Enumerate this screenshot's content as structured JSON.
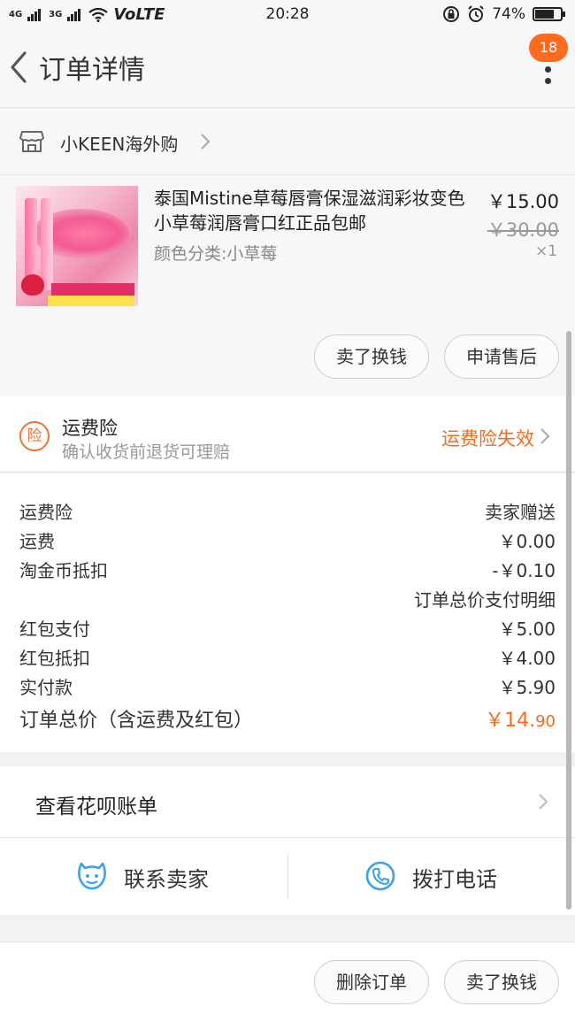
{
  "status_bar": {
    "signal1": "4G",
    "signal2": "3G",
    "volte": "VoLTE",
    "time": "20:28",
    "battery": "74%",
    "battery_level": 0.74
  },
  "header": {
    "title": "订单详情",
    "badge": "18"
  },
  "shop": {
    "name": "小KEEN海外购"
  },
  "item": {
    "title": "泰国Mistine草莓唇膏保湿滋润彩妆变色小草莓润唇膏口红正品包邮",
    "spec": "颜色分类:小草莓",
    "price": "￥15.00",
    "original_price": "￥30.00",
    "quantity": "×1",
    "actions": [
      "卖了换钱",
      "申请售后"
    ]
  },
  "insurance": {
    "title": "运费险",
    "subtitle": "确认收货前退货可理赔",
    "status": "运费险失效"
  },
  "fees": [
    {
      "key": "运费险",
      "value": "卖家赠送"
    },
    {
      "key": "运费",
      "value": "￥0.00"
    },
    {
      "key": "淘金币抵扣",
      "value": "-￥0.10"
    },
    {
      "key": "",
      "value": "订单总价支付明细"
    },
    {
      "key": "红包支付",
      "value": "￥5.00"
    },
    {
      "key": "红包抵扣",
      "value": "￥4.00"
    },
    {
      "key": "实付款",
      "value": "￥5.90"
    }
  ],
  "total": {
    "label": "订单总价（含运费及红包）",
    "value_main": "￥14.",
    "value_cents": "90"
  },
  "huabei": {
    "label": "查看花呗账单"
  },
  "contact": {
    "seller": "联系卖家",
    "call": "拨打电话"
  },
  "bottom_actions": [
    "删除订单",
    "卖了换钱"
  ],
  "colors": {
    "accent": "#f36a21",
    "badge": "#ff6a1f",
    "contact_blue": "#3ba1ea"
  }
}
